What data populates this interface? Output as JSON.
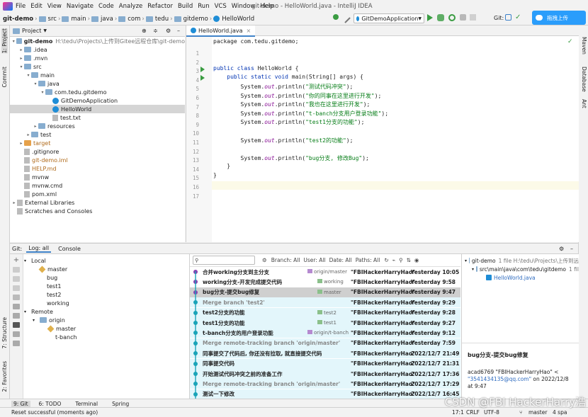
{
  "menu": [
    "File",
    "Edit",
    "View",
    "Navigate",
    "Code",
    "Analyze",
    "Refactor",
    "Build",
    "Run",
    "VCS",
    "Window",
    "Help"
  ],
  "window_title": "git-demo - HelloWorld.java - IntelliJ IDEA",
  "breadcrumb": [
    "git-demo",
    "src",
    "main",
    "java",
    "com",
    "tedu",
    "gitdemo",
    "HelloWorld"
  ],
  "run_config": "GitDemoApplication",
  "git_label": "Git:",
  "upload_label": "拖拽上传",
  "left_strip": [
    "1: Project",
    "Commit",
    "7: Structure",
    "2: Favorites"
  ],
  "right_strip": [
    "Maven",
    "Database",
    "Ant"
  ],
  "project": {
    "title": "Project",
    "tree": [
      {
        "label": "git-demo",
        "extra": "H:\\tedu\\Projects\\上传到Gitee远程仓库\\git-demo",
        "indent": 0,
        "arrow": "▾",
        "icon": "folder",
        "bold": true
      },
      {
        "label": ".idea",
        "indent": 1,
        "arrow": "▸",
        "icon": "folder"
      },
      {
        "label": ".mvn",
        "indent": 1,
        "arrow": "▸",
        "icon": "folder"
      },
      {
        "label": "src",
        "indent": 1,
        "arrow": "▾",
        "icon": "folder"
      },
      {
        "label": "main",
        "indent": 2,
        "arrow": "▾",
        "icon": "folder"
      },
      {
        "label": "java",
        "indent": 3,
        "arrow": "▾",
        "icon": "folder"
      },
      {
        "label": "com.tedu.gitdemo",
        "indent": 4,
        "arrow": "▾",
        "icon": "folder"
      },
      {
        "label": "GitDemoApplication",
        "indent": 5,
        "arrow": "",
        "icon": "java"
      },
      {
        "label": "HelloWorld",
        "indent": 5,
        "arrow": "",
        "icon": "java",
        "selected": true
      },
      {
        "label": "test.txt",
        "indent": 5,
        "arrow": "",
        "icon": "file"
      },
      {
        "label": "resources",
        "indent": 3,
        "arrow": "▸",
        "icon": "folder"
      },
      {
        "label": "test",
        "indent": 2,
        "arrow": "▸",
        "icon": "folder"
      },
      {
        "label": "target",
        "indent": 1,
        "arrow": "▸",
        "icon": "folder-orange",
        "color": "#b06a1a"
      },
      {
        "label": ".gitignore",
        "indent": 1,
        "arrow": "",
        "icon": "file"
      },
      {
        "label": "git-demo.iml",
        "indent": 1,
        "arrow": "",
        "icon": "file",
        "color": "#b06a1a"
      },
      {
        "label": "HELP.md",
        "indent": 1,
        "arrow": "",
        "icon": "file",
        "color": "#b06a1a"
      },
      {
        "label": "mvnw",
        "indent": 1,
        "arrow": "",
        "icon": "file"
      },
      {
        "label": "mvnw.cmd",
        "indent": 1,
        "arrow": "",
        "icon": "file"
      },
      {
        "label": "pom.xml",
        "indent": 1,
        "arrow": "",
        "icon": "file"
      },
      {
        "label": "External Libraries",
        "indent": 0,
        "arrow": "▸",
        "icon": "file"
      },
      {
        "label": "Scratches and Consoles",
        "indent": 0,
        "arrow": "",
        "icon": "file"
      }
    ]
  },
  "editor": {
    "tab": "HelloWorld.java",
    "lines": [
      [
        {
          "t": "package com.tedu.gitdemo;",
          "c": ""
        }
      ],
      [],
      [],
      [
        {
          "t": "public class ",
          "c": "kw"
        },
        {
          "t": "HelloWorld {",
          "c": ""
        }
      ],
      [
        {
          "t": "    public static void ",
          "c": "kw"
        },
        {
          "t": "main(String[] args) {",
          "c": ""
        }
      ],
      [
        {
          "t": "        System.",
          "c": ""
        },
        {
          "t": "out",
          "c": "fld"
        },
        {
          "t": ".println(",
          "c": ""
        },
        {
          "t": "\"测试代码冲突\"",
          "c": "str"
        },
        {
          "t": ");",
          "c": ""
        }
      ],
      [
        {
          "t": "        System.",
          "c": ""
        },
        {
          "t": "out",
          "c": "fld"
        },
        {
          "t": ".println(",
          "c": ""
        },
        {
          "t": "\"你的同事在这里进行开发\"",
          "c": "str"
        },
        {
          "t": ");",
          "c": ""
        }
      ],
      [
        {
          "t": "        System.",
          "c": ""
        },
        {
          "t": "out",
          "c": "fld"
        },
        {
          "t": ".println(",
          "c": ""
        },
        {
          "t": "\"我也在这里进行开发\"",
          "c": "str"
        },
        {
          "t": ");",
          "c": ""
        }
      ],
      [
        {
          "t": "        System.",
          "c": ""
        },
        {
          "t": "out",
          "c": "fld"
        },
        {
          "t": ".println(",
          "c": ""
        },
        {
          "t": "\"t-banch分支用户登录功能\"",
          "c": "str"
        },
        {
          "t": ");",
          "c": ""
        }
      ],
      [
        {
          "t": "        System.",
          "c": ""
        },
        {
          "t": "out",
          "c": "fld"
        },
        {
          "t": ".println(",
          "c": ""
        },
        {
          "t": "\"test1分支的功能\"",
          "c": "str"
        },
        {
          "t": ");",
          "c": ""
        }
      ],
      [],
      [
        {
          "t": "        System.",
          "c": ""
        },
        {
          "t": "out",
          "c": "fld"
        },
        {
          "t": ".println(",
          "c": ""
        },
        {
          "t": "\"test2的功能\"",
          "c": "str"
        },
        {
          "t": ");",
          "c": ""
        }
      ],
      [],
      [
        {
          "t": "        System.",
          "c": ""
        },
        {
          "t": "out",
          "c": "fld"
        },
        {
          "t": ".println(",
          "c": ""
        },
        {
          "t": "\"bug分支, 修改Bug\"",
          "c": "str"
        },
        {
          "t": ");",
          "c": ""
        }
      ],
      [
        {
          "t": "    }",
          "c": ""
        }
      ],
      [
        {
          "t": "}",
          "c": ""
        }
      ],
      []
    ]
  },
  "git": {
    "tabs": [
      "Git:",
      "Log: all",
      "Console"
    ],
    "branches": [
      {
        "label": "Local",
        "indent": 0,
        "arrow": "▾"
      },
      {
        "label": "master",
        "indent": 1,
        "tag": true
      },
      {
        "label": "bug",
        "indent": 1
      },
      {
        "label": "test1",
        "indent": 1
      },
      {
        "label": "test2",
        "indent": 1
      },
      {
        "label": "working",
        "indent": 1
      },
      {
        "label": "Remote",
        "indent": 0,
        "arrow": "▾"
      },
      {
        "label": "origin",
        "indent": 1,
        "arrow": "▾",
        "folder": true
      },
      {
        "label": "master",
        "indent": 2,
        "tag": true
      },
      {
        "label": "t-banch",
        "indent": 2
      }
    ],
    "filter": [
      "Branch: All",
      "User: All",
      "Date: All",
      "Paths: All"
    ],
    "commits": [
      {
        "msg": "合并working分支到主分支",
        "label": "origin/master",
        "author": "\"FBIHackerHarryHao\"",
        "date": "Yesterday 10:05",
        "style": "",
        "gray": false
      },
      {
        "msg": "working分支-开发完成提交代码",
        "label": "working",
        "author": "\"FBIHackerHarryHao\"",
        "date": "Yesterday 9:58",
        "style": "",
        "gray": false
      },
      {
        "msg": "bug分支-提交bug修复",
        "label": "master",
        "author": "\"FBIHackerHarryHao\"",
        "date": "Yesterday 9:47",
        "style": "sel",
        "gray": false
      },
      {
        "msg": "Merge branch 'test2'",
        "label": "",
        "author": "\"FBIHackerHarryHao\"",
        "date": "Yesterday 9:29",
        "style": "cy",
        "gray": true
      },
      {
        "msg": "test2分支的功能",
        "label": "test2",
        "author": "\"FBIHackerHarryHao\"",
        "date": "Yesterday 9:28",
        "style": "cy",
        "gray": false
      },
      {
        "msg": "test1分支的功能",
        "label": "test1",
        "author": "\"FBIHackerHarryHao\"",
        "date": "Yesterday 9:27",
        "style": "cy",
        "gray": false
      },
      {
        "msg": "t-banch分支的用户登录功能",
        "label": "origin/t-banch",
        "author": "\"FBIHackerHarryHao\"",
        "date": "Yesterday 9:12",
        "style": "cy",
        "gray": false
      },
      {
        "msg": "Merge remote-tracking branch 'origin/master'",
        "label": "",
        "author": "\"FBIHackerHarryHao\"",
        "date": "Yesterday 7:59",
        "style": "cy",
        "gray": true
      },
      {
        "msg": "同事提交了代码后, 你还没有拉取, 就直接提交代码",
        "label": "",
        "author": "\"FBIHackerHarryHao\"",
        "date": "2022/12/7 21:49",
        "style": "cy",
        "gray": false
      },
      {
        "msg": "同事提交代码",
        "label": "",
        "author": "\"FBIHackerHarryHao\"",
        "date": "2022/12/7 21:31",
        "style": "cy",
        "gray": false
      },
      {
        "msg": "开始测试代码冲突之前的准备工作",
        "label": "",
        "author": "\"FBIHackerHarryHao\"",
        "date": "2022/12/7 17:36",
        "style": "cy",
        "gray": false
      },
      {
        "msg": "Merge remote-tracking branch 'origin/master'",
        "label": "",
        "author": "\"FBIHackerHarryHao\"",
        "date": "2022/12/7 17:29",
        "style": "cy",
        "gray": true
      },
      {
        "msg": "测试一下修改",
        "label": "",
        "author": "\"FBIHackerHarryHao\"",
        "date": "2022/12/7 16:45",
        "style": "cy",
        "gray": false
      }
    ],
    "details": {
      "root": "git-demo",
      "root_info": "1 file  H:\\tedu\\Projects\\上传到远",
      "path": "src\\main\\java\\com\\tedu\\gitdemo",
      "path_info": "1 fil",
      "file": "HelloWorld.java",
      "commit_msg": "bug分支-提交bug修复",
      "hash_line": "acad6769 \"FBIHackerHarryHao\" <",
      "email": "\"3541434135@qq.com\"",
      "on_date": " on 2022/12/8",
      "at_time": "at 9:47"
    }
  },
  "bottom_tabs": [
    "9: Git",
    "6: TODO",
    "Terminal",
    "Spring"
  ],
  "status": {
    "message": "Reset successful (moments ago)",
    "pos": "17:1",
    "crlf": "CRLF",
    "enc": "UTF-8",
    "branch": "master",
    "spaces": "4 spa"
  },
  "watermark": "CSDN @FBI HackerHarry浩"
}
